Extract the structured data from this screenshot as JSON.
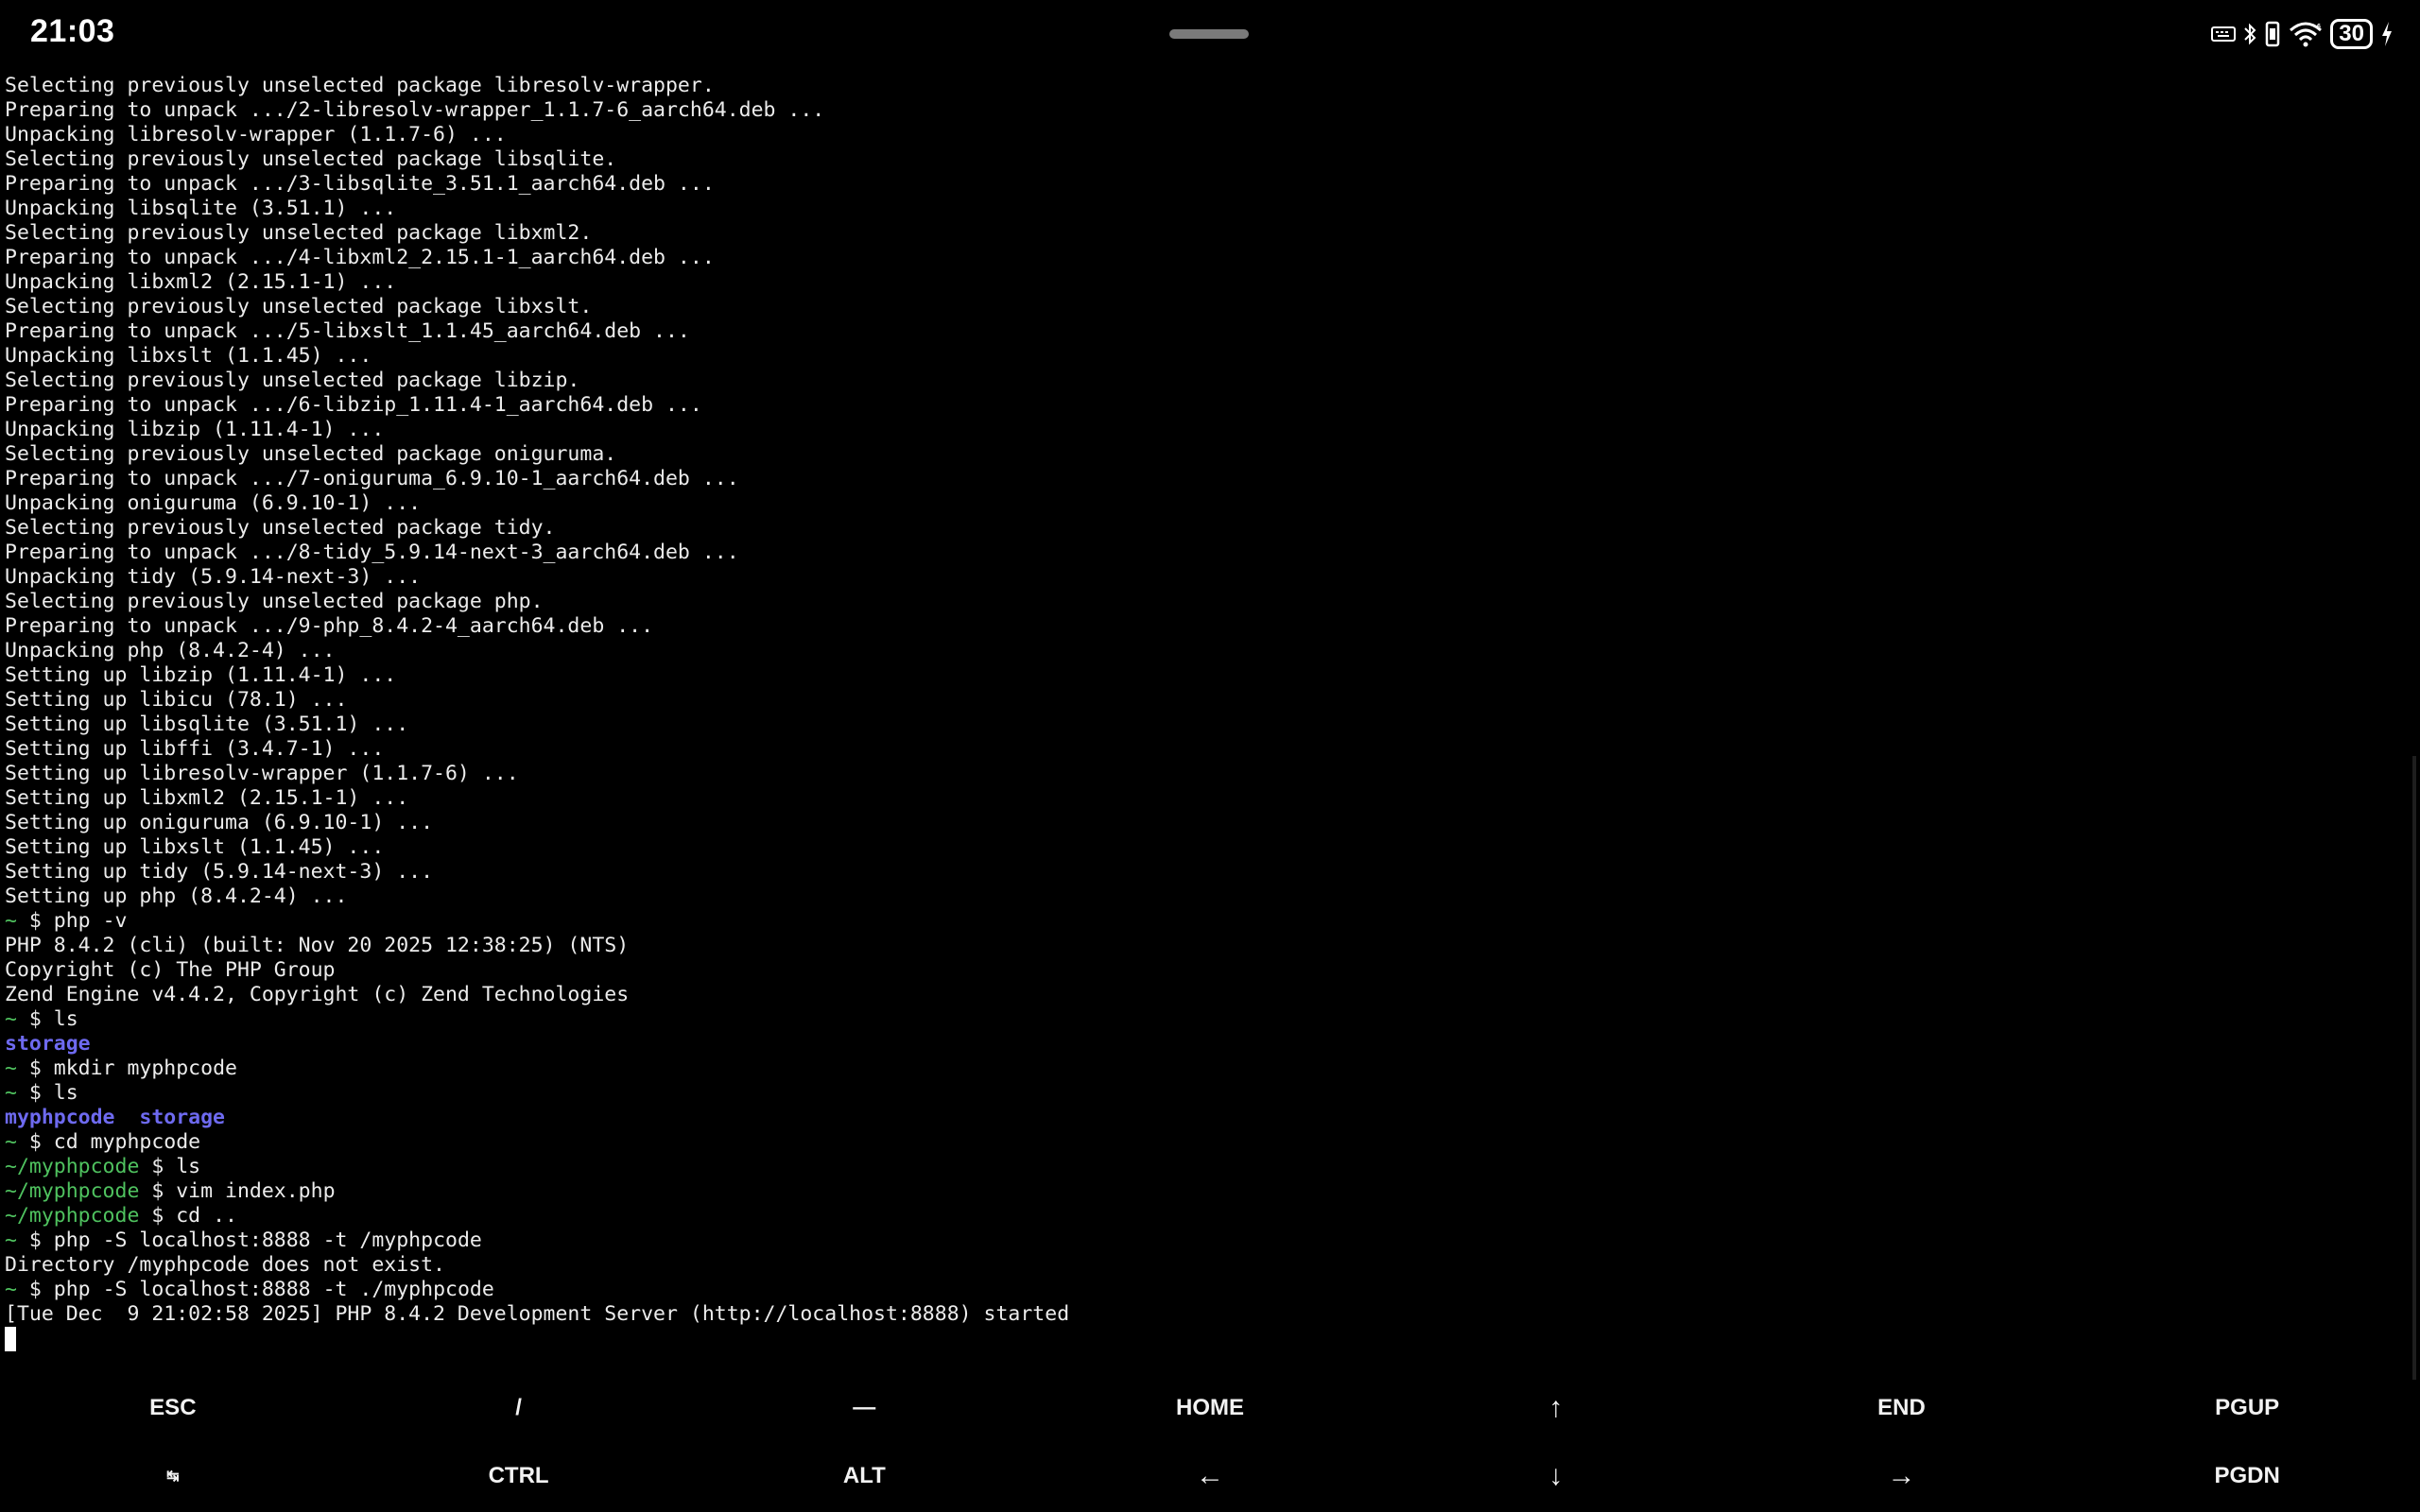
{
  "status_bar": {
    "time": "21:03",
    "battery_level": "30",
    "icons": [
      "keyboard-icon",
      "bluetooth-icon",
      "vibrate-icon",
      "wifi-icon",
      "battery-icon",
      "charging-icon"
    ]
  },
  "terminal": {
    "lines": [
      {
        "type": "out",
        "text": "Selecting previously unselected package libresolv-wrapper."
      },
      {
        "type": "out",
        "text": "Preparing to unpack .../2-libresolv-wrapper_1.1.7-6_aarch64.deb ..."
      },
      {
        "type": "out",
        "text": "Unpacking libresolv-wrapper (1.1.7-6) ..."
      },
      {
        "type": "out",
        "text": "Selecting previously unselected package libsqlite."
      },
      {
        "type": "out",
        "text": "Preparing to unpack .../3-libsqlite_3.51.1_aarch64.deb ..."
      },
      {
        "type": "out",
        "text": "Unpacking libsqlite (3.51.1) ..."
      },
      {
        "type": "out",
        "text": "Selecting previously unselected package libxml2."
      },
      {
        "type": "out",
        "text": "Preparing to unpack .../4-libxml2_2.15.1-1_aarch64.deb ..."
      },
      {
        "type": "out",
        "text": "Unpacking libxml2 (2.15.1-1) ..."
      },
      {
        "type": "out",
        "text": "Selecting previously unselected package libxslt."
      },
      {
        "type": "out",
        "text": "Preparing to unpack .../5-libxslt_1.1.45_aarch64.deb ..."
      },
      {
        "type": "out",
        "text": "Unpacking libxslt (1.1.45) ..."
      },
      {
        "type": "out",
        "text": "Selecting previously unselected package libzip."
      },
      {
        "type": "out",
        "text": "Preparing to unpack .../6-libzip_1.11.4-1_aarch64.deb ..."
      },
      {
        "type": "out",
        "text": "Unpacking libzip (1.11.4-1) ..."
      },
      {
        "type": "out",
        "text": "Selecting previously unselected package oniguruma."
      },
      {
        "type": "out",
        "text": "Preparing to unpack .../7-oniguruma_6.9.10-1_aarch64.deb ..."
      },
      {
        "type": "out",
        "text": "Unpacking oniguruma (6.9.10-1) ..."
      },
      {
        "type": "out",
        "text": "Selecting previously unselected package tidy."
      },
      {
        "type": "out",
        "text": "Preparing to unpack .../8-tidy_5.9.14-next-3_aarch64.deb ..."
      },
      {
        "type": "out",
        "text": "Unpacking tidy (5.9.14-next-3) ..."
      },
      {
        "type": "out",
        "text": "Selecting previously unselected package php."
      },
      {
        "type": "out",
        "text": "Preparing to unpack .../9-php_8.4.2-4_aarch64.deb ..."
      },
      {
        "type": "out",
        "text": "Unpacking php (8.4.2-4) ..."
      },
      {
        "type": "out",
        "text": "Setting up libzip (1.11.4-1) ..."
      },
      {
        "type": "out",
        "text": "Setting up libicu (78.1) ..."
      },
      {
        "type": "out",
        "text": "Setting up libsqlite (3.51.1) ..."
      },
      {
        "type": "out",
        "text": "Setting up libffi (3.4.7-1) ..."
      },
      {
        "type": "out",
        "text": "Setting up libresolv-wrapper (1.1.7-6) ..."
      },
      {
        "type": "out",
        "text": "Setting up libxml2 (2.15.1-1) ..."
      },
      {
        "type": "out",
        "text": "Setting up oniguruma (6.9.10-1) ..."
      },
      {
        "type": "out",
        "text": "Setting up libxslt (1.1.45) ..."
      },
      {
        "type": "out",
        "text": "Setting up tidy (5.9.14-next-3) ..."
      },
      {
        "type": "out",
        "text": "Setting up php (8.4.2-4) ..."
      },
      {
        "type": "cmd",
        "path": "~",
        "command": "php -v"
      },
      {
        "type": "out",
        "text": "PHP 8.4.2 (cli) (built: Nov 20 2025 12:38:25) (NTS)"
      },
      {
        "type": "out",
        "text": "Copyright (c) The PHP Group"
      },
      {
        "type": "out",
        "text": "Zend Engine v4.4.2, Copyright (c) Zend Technologies"
      },
      {
        "type": "cmd",
        "path": "~",
        "command": "ls"
      },
      {
        "type": "dir",
        "text": "storage"
      },
      {
        "type": "cmd",
        "path": "~",
        "command": "mkdir myphpcode"
      },
      {
        "type": "cmd",
        "path": "~",
        "command": "ls"
      },
      {
        "type": "dir",
        "text": "myphpcode  storage"
      },
      {
        "type": "cmd",
        "path": "~",
        "command": "cd myphpcode"
      },
      {
        "type": "cmd",
        "path": "~/myphpcode",
        "command": "ls"
      },
      {
        "type": "cmd",
        "path": "~/myphpcode",
        "command": "vim index.php"
      },
      {
        "type": "cmd",
        "path": "~/myphpcode",
        "command": "cd .."
      },
      {
        "type": "cmd",
        "path": "~",
        "command": "php -S localhost:8888 -t /myphpcode"
      },
      {
        "type": "out",
        "text": "Directory /myphpcode does not exist."
      },
      {
        "type": "cmd",
        "path": "~",
        "command": "php -S localhost:8888 -t ./myphpcode"
      },
      {
        "type": "out",
        "text": "[Tue Dec  9 21:02:58 2025] PHP 8.4.2 Development Server (http://localhost:8888) started"
      },
      {
        "type": "cursor"
      }
    ]
  },
  "extra_keys": {
    "row1": [
      {
        "label": "ESC",
        "name": "esc-key"
      },
      {
        "label": "/",
        "name": "slash-key"
      },
      {
        "label": "—",
        "name": "dash-key"
      },
      {
        "label": "HOME",
        "name": "home-key"
      },
      {
        "label": "↑",
        "name": "arrow-up-key"
      },
      {
        "label": "END",
        "name": "end-key"
      },
      {
        "label": "PGUP",
        "name": "pgup-key"
      }
    ],
    "row2": [
      {
        "label": "↹",
        "name": "tab-key"
      },
      {
        "label": "CTRL",
        "name": "ctrl-key"
      },
      {
        "label": "ALT",
        "name": "alt-key"
      },
      {
        "label": "←",
        "name": "arrow-left-key"
      },
      {
        "label": "↓",
        "name": "arrow-down-key"
      },
      {
        "label": "→",
        "name": "arrow-right-key"
      },
      {
        "label": "PGDN",
        "name": "pgdn-key"
      }
    ]
  }
}
